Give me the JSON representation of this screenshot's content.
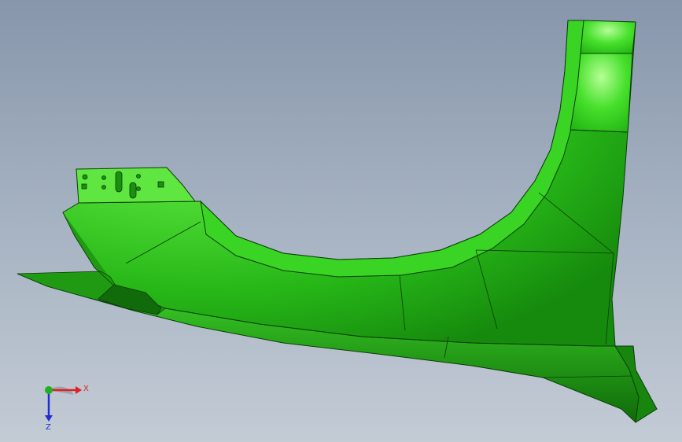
{
  "viewport": {
    "background_top": "#8796ab",
    "background_bottom": "#c3cbd5"
  },
  "model": {
    "part_color": "#2fcf1f",
    "highlight_color": "#b8ff9c",
    "shadow_color": "#116f0b",
    "edge_color": "#0b3d08"
  },
  "triad": {
    "x_label": "X",
    "z_label": "Z",
    "x_color": "#e02020",
    "y_color": "#20b020",
    "z_color": "#2030d0"
  }
}
